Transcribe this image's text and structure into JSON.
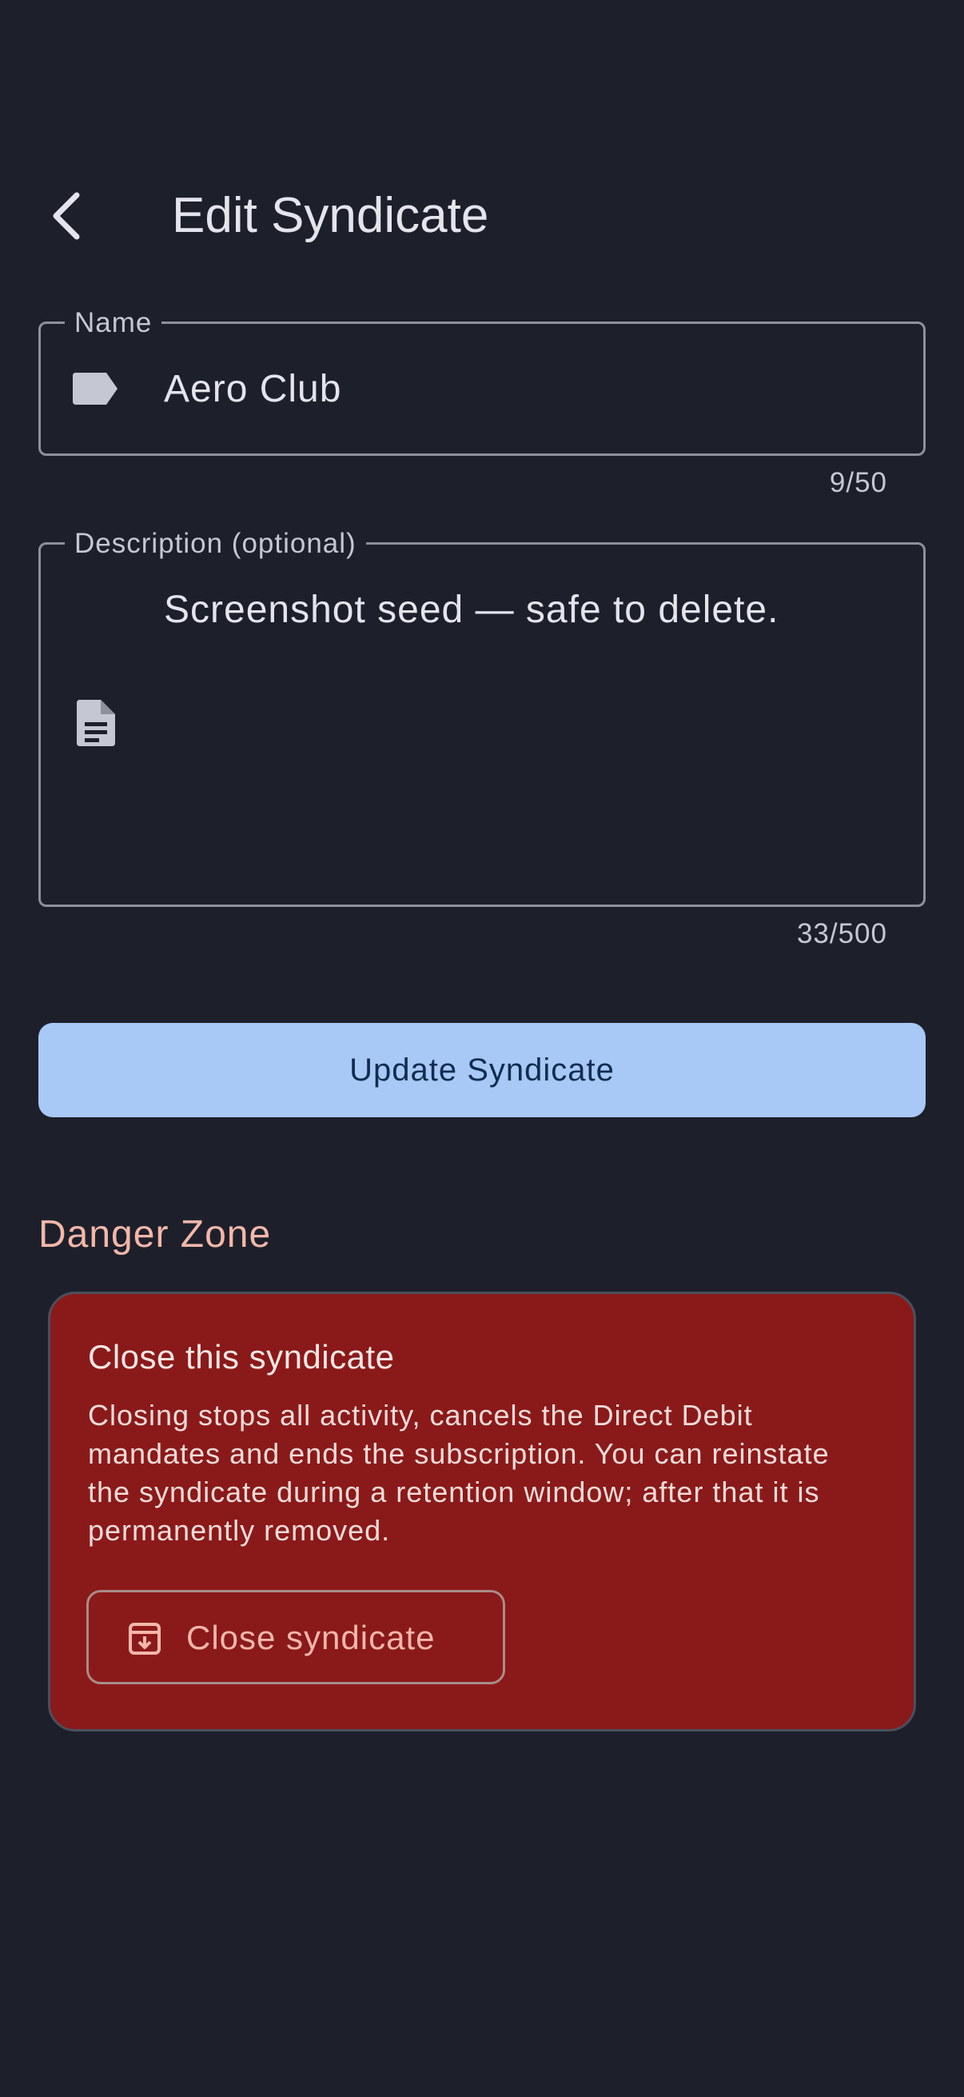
{
  "header": {
    "title": "Edit Syndicate",
    "back_icon": "arrow-back-icon"
  },
  "form": {
    "name": {
      "label": "Name",
      "value": "Aero Club",
      "counter": "9/50",
      "icon": "label-tag-icon"
    },
    "description": {
      "label": "Description (optional)",
      "value": "Screenshot seed — safe to delete.",
      "counter": "33/500",
      "icon": "document-icon"
    },
    "submit_label": "Update Syndicate"
  },
  "danger_zone": {
    "heading": "Danger Zone",
    "card_title": "Close this syndicate",
    "card_body": "Closing stops all activity, cancels the Direct Debit mandates and ends the subscription. You can reinstate the syndicate during a retention window; after that it is permanently removed.",
    "button_label": "Close syndicate",
    "button_icon": "archive-icon"
  },
  "colors": {
    "background": "#1d202b",
    "primary_button": "#a8c8f5",
    "danger_card": "#8a1a19",
    "danger_text": "#f4b7a9"
  }
}
